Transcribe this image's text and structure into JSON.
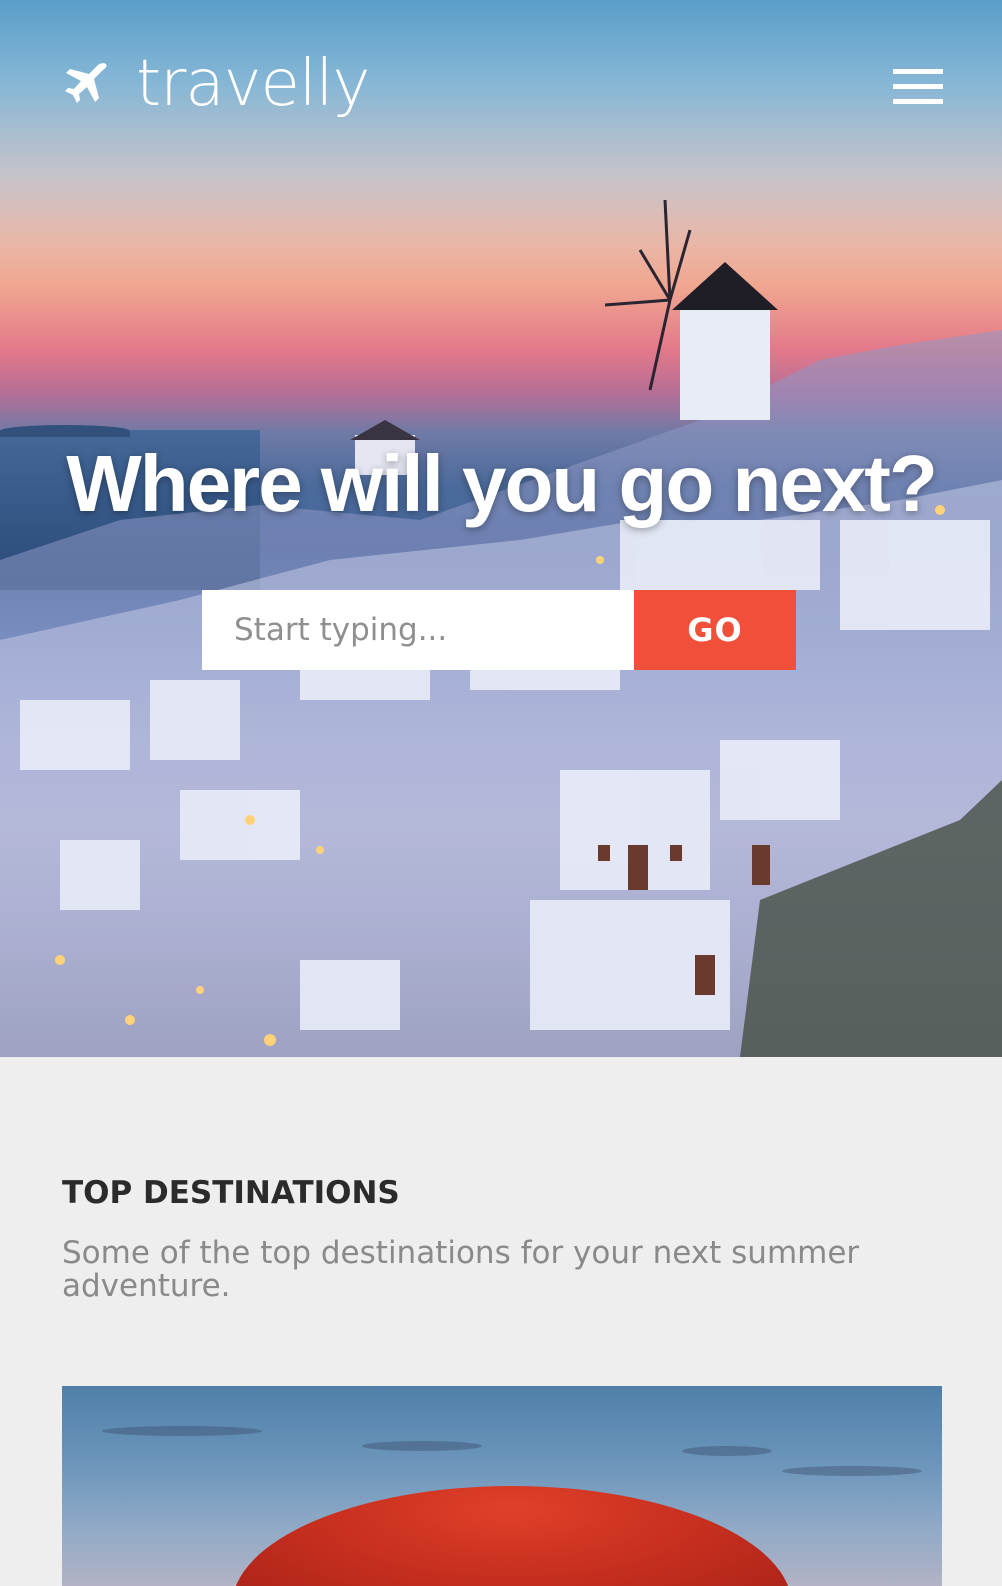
{
  "brand": {
    "name": "travelly",
    "logo_icon": "airplane-icon",
    "menu_icon": "hamburger-menu-icon"
  },
  "hero": {
    "title": "Where will you go next?",
    "search": {
      "placeholder": "Start typing...",
      "value": "",
      "button_label": "GO"
    }
  },
  "destinations": {
    "title": "TOP DESTINATIONS",
    "subtitle": "Some of the top destinations for your next summer adventure."
  },
  "colors": {
    "accent": "#f0503a",
    "section_background": "#eeeeee",
    "heading_text": "#2b2b2b",
    "muted_text": "#8a8a8a",
    "white": "#ffffff"
  }
}
